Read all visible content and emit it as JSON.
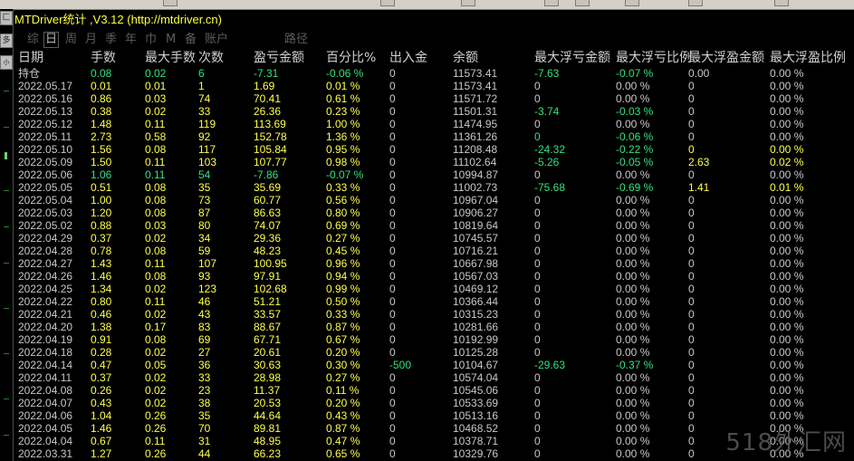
{
  "window": {
    "title": "MTDriver统计 ,V3.12 (http://mtdriver.cn)"
  },
  "left_strip": {
    "btn1": "匚",
    "btn2": "多",
    "btn3": "小"
  },
  "tabs": [
    {
      "label": "综"
    },
    {
      "label": "日"
    },
    {
      "label": "周"
    },
    {
      "label": "月"
    },
    {
      "label": "季"
    },
    {
      "label": "年"
    },
    {
      "label": "巾"
    },
    {
      "label": "M"
    },
    {
      "label": "备"
    },
    {
      "label": "账户"
    },
    {
      "label": "路径"
    }
  ],
  "columns": [
    "日期",
    "手数",
    "最大手数",
    "次数",
    "盈亏金额",
    "百分比%",
    "出入金",
    "余额",
    "最大浮亏金额",
    "最大浮亏比例",
    "最大浮盈金额",
    "最大浮盈比例"
  ],
  "rows": [
    {
      "d": "持仓",
      "lots": "0.08",
      "maxlots": "0.02",
      "cnt": "6",
      "pl": "-7.31",
      "pct": "-0.06 %",
      "io": "0",
      "bal": "11573.41",
      "mfl": "-7.63",
      "mflp": "-0.07 %",
      "mfp": "0.00",
      "mfpp": "0.00 %",
      "lc": "neg",
      "plc": "neg",
      "mflc": "neg",
      "mfpc": "neu"
    },
    {
      "d": "2022.05.17",
      "lots": "0.01",
      "maxlots": "0.01",
      "cnt": "1",
      "pl": "1.69",
      "pct": "0.01 %",
      "io": "0",
      "bal": "11573.41",
      "mfl": "0",
      "mflp": "0.00 %",
      "mfp": "0",
      "mfpp": "0.00 %",
      "lc": "pos",
      "plc": "pos",
      "mflc": "neu",
      "mfpc": "neu"
    },
    {
      "d": "2022.05.16",
      "lots": "0.86",
      "maxlots": "0.03",
      "cnt": "74",
      "pl": "70.41",
      "pct": "0.61 %",
      "io": "0",
      "bal": "11571.72",
      "mfl": "0",
      "mflp": "0.00 %",
      "mfp": "0",
      "mfpp": "0.00 %",
      "lc": "pos",
      "plc": "pos",
      "mflc": "neu",
      "mfpc": "neu"
    },
    {
      "d": "2022.05.13",
      "lots": "0.38",
      "maxlots": "0.02",
      "cnt": "33",
      "pl": "26.36",
      "pct": "0.23 %",
      "io": "0",
      "bal": "11501.31",
      "mfl": "-3.74",
      "mflp": "-0.03 %",
      "mfp": "0",
      "mfpp": "0.00 %",
      "lc": "pos",
      "plc": "pos",
      "mflc": "neg",
      "mfpc": "neu"
    },
    {
      "d": "2022.05.12",
      "lots": "1.48",
      "maxlots": "0.11",
      "cnt": "119",
      "pl": "113.69",
      "pct": "1.00 %",
      "io": "0",
      "bal": "11474.95",
      "mfl": "0",
      "mflp": "0.00 %",
      "mfp": "0",
      "mfpp": "0.00 %",
      "lc": "pos",
      "plc": "pos",
      "mflc": "neu",
      "mfpc": "neu"
    },
    {
      "d": "2022.05.11",
      "lots": "2.73",
      "maxlots": "0.58",
      "cnt": "92",
      "pl": "152.78",
      "pct": "1.36 %",
      "io": "0",
      "bal": "11361.26",
      "mfl": "0",
      "mflp": "-0.06 %",
      "mfp": "0",
      "mfpp": "0.00 %",
      "lc": "pos",
      "plc": "pos",
      "mflc": "neg",
      "mfpc": "neu"
    },
    {
      "d": "2022.05.10",
      "lots": "1.56",
      "maxlots": "0.08",
      "cnt": "117",
      "pl": "105.84",
      "pct": "0.95 %",
      "io": "0",
      "bal": "11208.48",
      "mfl": "-24.32",
      "mflp": "-0.22 %",
      "mfp": "0",
      "mfpp": "0.00 %",
      "lc": "pos",
      "plc": "pos",
      "mflc": "neg",
      "mfpc": "pos"
    },
    {
      "d": "2022.05.09",
      "lots": "1.50",
      "maxlots": "0.11",
      "cnt": "103",
      "pl": "107.77",
      "pct": "0.98 %",
      "io": "0",
      "bal": "11102.64",
      "mfl": "-5.26",
      "mflp": "-0.05 %",
      "mfp": "2.63",
      "mfpp": "0.02 %",
      "lc": "pos",
      "plc": "pos",
      "mflc": "neg",
      "mfpc": "pos"
    },
    {
      "d": "2022.05.06",
      "lots": "1.06",
      "maxlots": "0.11",
      "cnt": "54",
      "pl": "-7.86",
      "pct": "-0.07 %",
      "io": "0",
      "bal": "10994.87",
      "mfl": "0",
      "mflp": "0.00 %",
      "mfp": "0",
      "mfpp": "0.00 %",
      "lc": "neg",
      "plc": "neg",
      "mflc": "neu",
      "mfpc": "neu"
    },
    {
      "d": "2022.05.05",
      "lots": "0.51",
      "maxlots": "0.08",
      "cnt": "35",
      "pl": "35.69",
      "pct": "0.33 %",
      "io": "0",
      "bal": "11002.73",
      "mfl": "-75.68",
      "mflp": "-0.69 %",
      "mfp": "1.41",
      "mfpp": "0.01 %",
      "lc": "pos",
      "plc": "pos",
      "mflc": "neg",
      "mfpc": "pos"
    },
    {
      "d": "2022.05.04",
      "lots": "1.00",
      "maxlots": "0.08",
      "cnt": "73",
      "pl": "60.77",
      "pct": "0.56 %",
      "io": "0",
      "bal": "10967.04",
      "mfl": "0",
      "mflp": "0.00 %",
      "mfp": "0",
      "mfpp": "0.00 %",
      "lc": "pos",
      "plc": "pos",
      "mflc": "neu",
      "mfpc": "neu"
    },
    {
      "d": "2022.05.03",
      "lots": "1.20",
      "maxlots": "0.08",
      "cnt": "87",
      "pl": "86.63",
      "pct": "0.80 %",
      "io": "0",
      "bal": "10906.27",
      "mfl": "0",
      "mflp": "0.00 %",
      "mfp": "0",
      "mfpp": "0.00 %",
      "lc": "pos",
      "plc": "pos",
      "mflc": "neu",
      "mfpc": "neu"
    },
    {
      "d": "2022.05.02",
      "lots": "0.88",
      "maxlots": "0.03",
      "cnt": "80",
      "pl": "74.07",
      "pct": "0.69 %",
      "io": "0",
      "bal": "10819.64",
      "mfl": "0",
      "mflp": "0.00 %",
      "mfp": "0",
      "mfpp": "0.00 %",
      "lc": "pos",
      "plc": "pos",
      "mflc": "neu",
      "mfpc": "neu"
    },
    {
      "d": "2022.04.29",
      "lots": "0.37",
      "maxlots": "0.02",
      "cnt": "34",
      "pl": "29.36",
      "pct": "0.27 %",
      "io": "0",
      "bal": "10745.57",
      "mfl": "0",
      "mflp": "0.00 %",
      "mfp": "0",
      "mfpp": "0.00 %",
      "lc": "pos",
      "plc": "pos",
      "mflc": "neu",
      "mfpc": "neu"
    },
    {
      "d": "2022.04.28",
      "lots": "0.78",
      "maxlots": "0.08",
      "cnt": "59",
      "pl": "48.23",
      "pct": "0.45 %",
      "io": "0",
      "bal": "10716.21",
      "mfl": "0",
      "mflp": "0.00 %",
      "mfp": "0",
      "mfpp": "0.00 %",
      "lc": "pos",
      "plc": "pos",
      "mflc": "neu",
      "mfpc": "neu"
    },
    {
      "d": "2022.04.27",
      "lots": "1.43",
      "maxlots": "0.11",
      "cnt": "107",
      "pl": "100.95",
      "pct": "0.96 %",
      "io": "0",
      "bal": "10667.98",
      "mfl": "0",
      "mflp": "0.00 %",
      "mfp": "0",
      "mfpp": "0.00 %",
      "lc": "pos",
      "plc": "pos",
      "mflc": "neu",
      "mfpc": "neu"
    },
    {
      "d": "2022.04.26",
      "lots": "1.46",
      "maxlots": "0.08",
      "cnt": "93",
      "pl": "97.91",
      "pct": "0.94 %",
      "io": "0",
      "bal": "10567.03",
      "mfl": "0",
      "mflp": "0.00 %",
      "mfp": "0",
      "mfpp": "0.00 %",
      "lc": "pos",
      "plc": "pos",
      "mflc": "neu",
      "mfpc": "neu"
    },
    {
      "d": "2022.04.25",
      "lots": "1.34",
      "maxlots": "0.02",
      "cnt": "123",
      "pl": "102.68",
      "pct": "0.99 %",
      "io": "0",
      "bal": "10469.12",
      "mfl": "0",
      "mflp": "0.00 %",
      "mfp": "0",
      "mfpp": "0.00 %",
      "lc": "pos",
      "plc": "pos",
      "mflc": "neu",
      "mfpc": "neu"
    },
    {
      "d": "2022.04.22",
      "lots": "0.80",
      "maxlots": "0.11",
      "cnt": "46",
      "pl": "51.21",
      "pct": "0.50 %",
      "io": "0",
      "bal": "10366.44",
      "mfl": "0",
      "mflp": "0.00 %",
      "mfp": "0",
      "mfpp": "0.00 %",
      "lc": "pos",
      "plc": "pos",
      "mflc": "neu",
      "mfpc": "neu"
    },
    {
      "d": "2022.04.21",
      "lots": "0.46",
      "maxlots": "0.02",
      "cnt": "43",
      "pl": "33.57",
      "pct": "0.33 %",
      "io": "0",
      "bal": "10315.23",
      "mfl": "0",
      "mflp": "0.00 %",
      "mfp": "0",
      "mfpp": "0.00 %",
      "lc": "pos",
      "plc": "pos",
      "mflc": "neu",
      "mfpc": "neu"
    },
    {
      "d": "2022.04.20",
      "lots": "1.38",
      "maxlots": "0.17",
      "cnt": "83",
      "pl": "88.67",
      "pct": "0.87 %",
      "io": "0",
      "bal": "10281.66",
      "mfl": "0",
      "mflp": "0.00 %",
      "mfp": "0",
      "mfpp": "0.00 %",
      "lc": "pos",
      "plc": "pos",
      "mflc": "neu",
      "mfpc": "neu"
    },
    {
      "d": "2022.04.19",
      "lots": "0.91",
      "maxlots": "0.08",
      "cnt": "69",
      "pl": "67.71",
      "pct": "0.67 %",
      "io": "0",
      "bal": "10192.99",
      "mfl": "0",
      "mflp": "0.00 %",
      "mfp": "0",
      "mfpp": "0.00 %",
      "lc": "pos",
      "plc": "pos",
      "mflc": "neu",
      "mfpc": "neu"
    },
    {
      "d": "2022.04.18",
      "lots": "0.28",
      "maxlots": "0.02",
      "cnt": "27",
      "pl": "20.61",
      "pct": "0.20 %",
      "io": "0",
      "bal": "10125.28",
      "mfl": "0",
      "mflp": "0.00 %",
      "mfp": "0",
      "mfpp": "0.00 %",
      "lc": "pos",
      "plc": "pos",
      "mflc": "neu",
      "mfpc": "neu"
    },
    {
      "d": "2022.04.14",
      "lots": "0.47",
      "maxlots": "0.05",
      "cnt": "36",
      "pl": "30.63",
      "pct": "0.30 %",
      "io": "-500",
      "bal": "10104.67",
      "mfl": "-29.63",
      "mflp": "-0.37 %",
      "mfp": "0",
      "mfpp": "0.00 %",
      "lc": "pos",
      "plc": "pos",
      "mflc": "neg",
      "mfpc": "neu",
      "ioc": "neg"
    },
    {
      "d": "2022.04.11",
      "lots": "0.37",
      "maxlots": "0.02",
      "cnt": "33",
      "pl": "28.98",
      "pct": "0.27 %",
      "io": "0",
      "bal": "10574.04",
      "mfl": "0",
      "mflp": "0.00 %",
      "mfp": "0",
      "mfpp": "0.00 %",
      "lc": "pos",
      "plc": "pos",
      "mflc": "neu",
      "mfpc": "neu"
    },
    {
      "d": "2022.04.08",
      "lots": "0.26",
      "maxlots": "0.02",
      "cnt": "23",
      "pl": "11.37",
      "pct": "0.11 %",
      "io": "0",
      "bal": "10545.06",
      "mfl": "0",
      "mflp": "0.00 %",
      "mfp": "0",
      "mfpp": "0.00 %",
      "lc": "pos",
      "plc": "pos",
      "mflc": "neu",
      "mfpc": "neu"
    },
    {
      "d": "2022.04.07",
      "lots": "0.43",
      "maxlots": "0.02",
      "cnt": "38",
      "pl": "20.53",
      "pct": "0.20 %",
      "io": "0",
      "bal": "10533.69",
      "mfl": "0",
      "mflp": "0.00 %",
      "mfp": "0",
      "mfpp": "0.00 %",
      "lc": "pos",
      "plc": "pos",
      "mflc": "neu",
      "mfpc": "neu"
    },
    {
      "d": "2022.04.06",
      "lots": "1.04",
      "maxlots": "0.26",
      "cnt": "35",
      "pl": "44.64",
      "pct": "0.43 %",
      "io": "0",
      "bal": "10513.16",
      "mfl": "0",
      "mflp": "0.00 %",
      "mfp": "0",
      "mfpp": "0.00 %",
      "lc": "pos",
      "plc": "pos",
      "mflc": "neu",
      "mfpc": "neu"
    },
    {
      "d": "2022.04.05",
      "lots": "1.46",
      "maxlots": "0.26",
      "cnt": "70",
      "pl": "89.81",
      "pct": "0.87 %",
      "io": "0",
      "bal": "10468.52",
      "mfl": "0",
      "mflp": "0.00 %",
      "mfp": "0",
      "mfpp": "0.00 %",
      "lc": "pos",
      "plc": "pos",
      "mflc": "neu",
      "mfpc": "neu"
    },
    {
      "d": "2022.04.04",
      "lots": "0.67",
      "maxlots": "0.11",
      "cnt": "31",
      "pl": "48.95",
      "pct": "0.47 %",
      "io": "0",
      "bal": "10378.71",
      "mfl": "0",
      "mflp": "0.00 %",
      "mfp": "0",
      "mfpp": "0.00 %",
      "lc": "pos",
      "plc": "pos",
      "mflc": "neu",
      "mfpc": "neu"
    },
    {
      "d": "2022.03.31",
      "lots": "1.27",
      "maxlots": "0.26",
      "cnt": "44",
      "pl": "66.23",
      "pct": "0.65 %",
      "io": "0",
      "bal": "10329.76",
      "mfl": "0",
      "mflp": "0.00 %",
      "mfp": "0",
      "mfpp": "0.00 %",
      "lc": "pos",
      "plc": "pos",
      "mflc": "neu",
      "mfpc": "neu"
    }
  ],
  "watermark": "518外汇网",
  "colors": {
    "positive": "#ffff4a",
    "negative": "#33e080",
    "title": "#ffff3a",
    "background": "#000000"
  }
}
